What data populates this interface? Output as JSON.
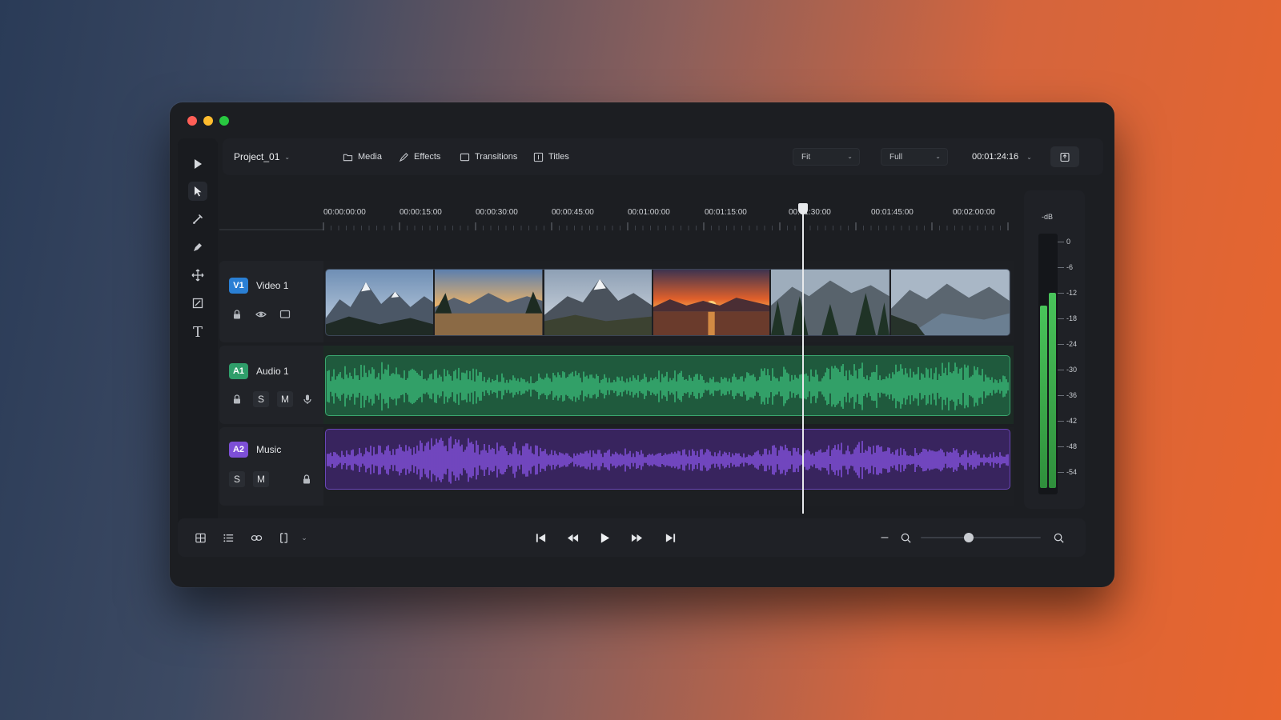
{
  "window": {
    "lights": [
      "#ff5f57",
      "#febc2e",
      "#28c840"
    ]
  },
  "toolrail": {
    "tools": [
      {
        "name": "play-tool-icon"
      },
      {
        "name": "select-arrow-icon"
      },
      {
        "name": "razor-icon"
      },
      {
        "name": "pen-icon"
      },
      {
        "name": "move-icon"
      },
      {
        "name": "crop-icon"
      },
      {
        "name": "text-tool-icon",
        "label": "T"
      }
    ]
  },
  "topbar": {
    "project": "Project_01",
    "tabs": [
      {
        "label": "Media",
        "icon": "folder-icon"
      },
      {
        "label": "Effects",
        "icon": "brush-icon"
      },
      {
        "label": "Transitions",
        "icon": "transition-icon"
      },
      {
        "label": "Titles",
        "icon": "titles-icon"
      }
    ],
    "zoom_select": "Fit",
    "quality_select": "Full",
    "timecode": "00:01:24:16",
    "export_icon": "export-icon"
  },
  "ruler": {
    "labels": [
      "00:00:00:00",
      "00:00:15:00",
      "00:00:30:00",
      "00:00:45:00",
      "00:01:00:00",
      "00:01:15:00",
      "00:01:30:00",
      "00:01:45:00",
      "00:02:00:00"
    ]
  },
  "tracks": {
    "video": {
      "badge": "V1",
      "name": "Video 1",
      "badge_color": "#2a7fd4"
    },
    "audio1": {
      "badge": "A1",
      "name": "Audio 1",
      "badge_color": "#2f9e6a",
      "solo": "S",
      "mute": "M"
    },
    "audio2": {
      "badge": "A2",
      "name": "Music",
      "badge_color": "#7d4fd6",
      "solo": "S",
      "mute": "M"
    }
  },
  "playhead_position_pct": 63,
  "meter": {
    "unit": "-dB",
    "scale": [
      "0",
      "-6",
      "-12",
      "-18",
      "-24",
      "-30",
      "-36",
      "-42",
      "-48",
      "-54"
    ],
    "left_level_db": -15,
    "right_level_db": -12
  },
  "transport": {
    "buttons": [
      "skip-back-icon",
      "rewind-icon",
      "play-icon",
      "fast-forward-icon",
      "skip-forward-icon"
    ]
  },
  "zoom": {
    "minus": "–",
    "level_pct": 40
  },
  "colors": {
    "audio_wave": "#3bbf7c",
    "music_wave": "#8a55e8",
    "meter_green": "#39b54a"
  }
}
